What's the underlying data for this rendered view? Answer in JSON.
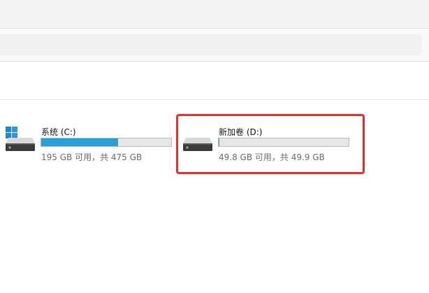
{
  "drives": [
    {
      "name": "系统 (C:)",
      "space_text": "195 GB 可用，共 475 GB",
      "used_fraction": 0.589,
      "icon": "hard-drive-windows-icon",
      "bar_color": "#26a0da"
    },
    {
      "name": "新加卷 (D:)",
      "space_text": "49.8 GB 可用，共 49.9 GB",
      "used_fraction": 0.002,
      "icon": "hard-drive-icon",
      "bar_color": "#26a0da"
    }
  ],
  "colors": {
    "highlight": "#e8302c",
    "bar_track": "#e6e6e6",
    "bar_fill": "#26a0da"
  }
}
